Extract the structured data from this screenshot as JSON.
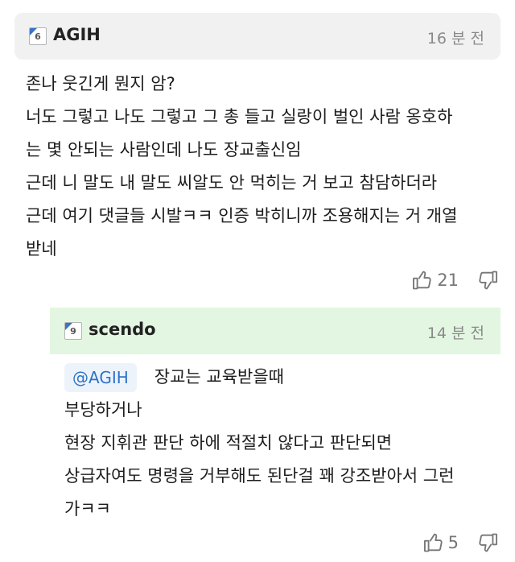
{
  "comment": {
    "level": "6",
    "username": "AGIH",
    "time": "16 분 전",
    "lines": [
      "존나 웃긴게 뭔지 암?",
      "너도 그렇고 나도 그렇고 그 총 들고 실랑이 벌인 사람 옹호하",
      "는 몇 안되는 사람인데 나도 장교출신임",
      "근데 니 말도 내 말도 씨알도 안 먹히는 거 보고 참담하더라",
      "근데 여기 댓글들 시발ㅋㅋ 인증 박히니까 조용해지는 거 개열",
      "받네"
    ],
    "likes": "21"
  },
  "reply": {
    "level": "9",
    "username": "scendo",
    "time": "14 분 전",
    "mention": "@AGIH",
    "lines": [
      "장교는 교육받을때",
      "부당하거나",
      "현장 지휘관 판단 하에 적절치 않다고 판단되면",
      "상급자여도 명령을 거부해도 된단걸 꽤 강조받아서 그런",
      "가ㅋㅋ"
    ],
    "likes": "5"
  }
}
